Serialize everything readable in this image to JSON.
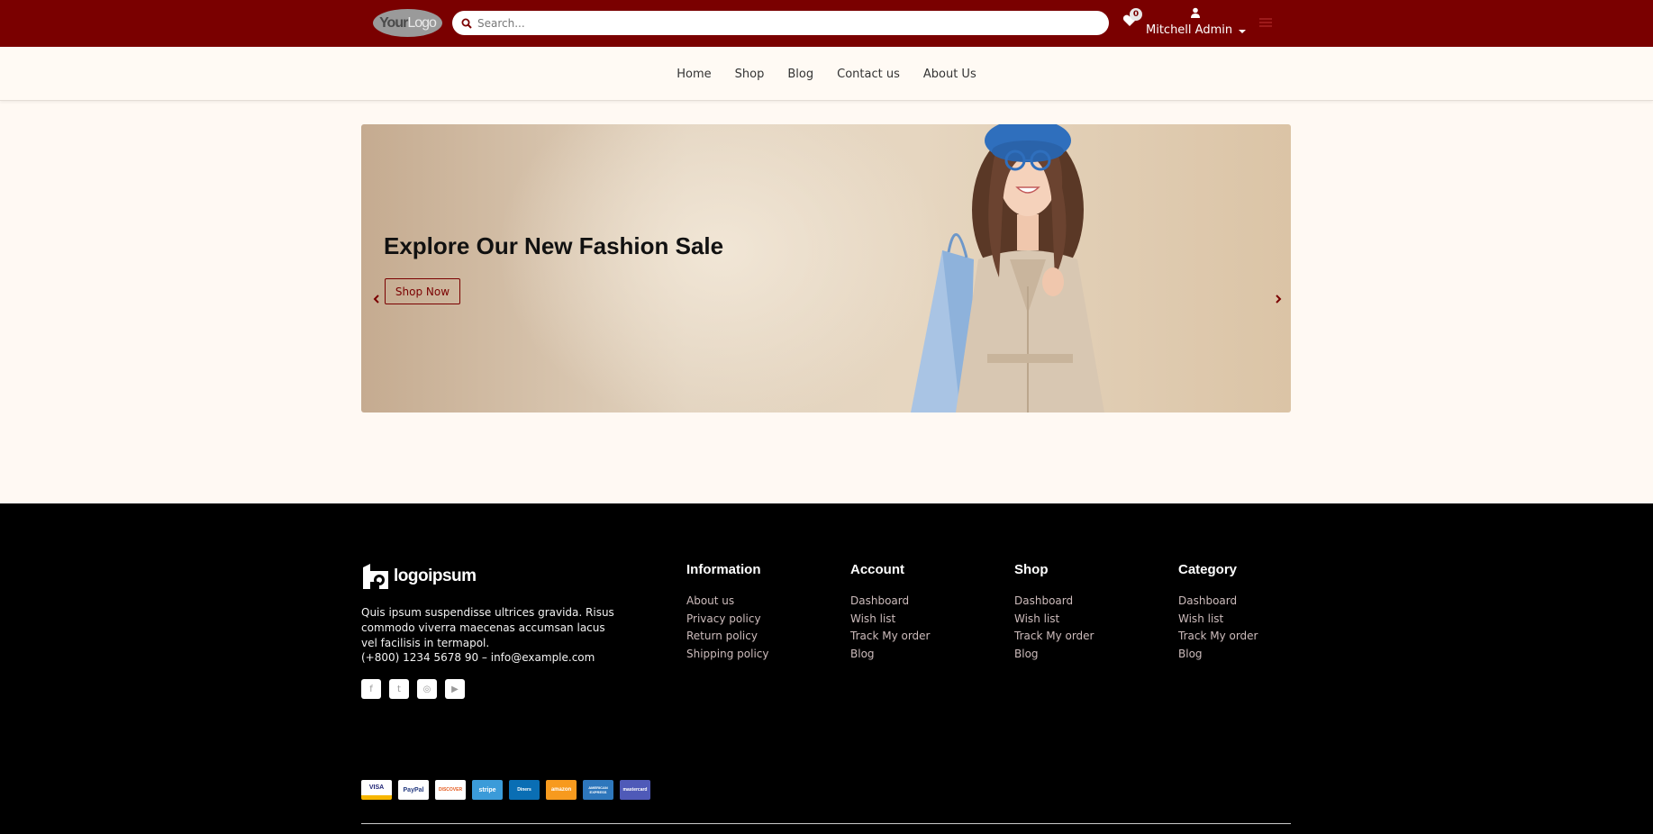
{
  "header": {
    "logo": {
      "bold": "Your",
      "light": "Logo"
    },
    "search_placeholder": "Search...",
    "wishlist_count": "0",
    "user_name": "Mitchell Admin"
  },
  "nav": {
    "items": [
      {
        "label": "Home"
      },
      {
        "label": "Shop"
      },
      {
        "label": "Blog"
      },
      {
        "label": "Contact us"
      },
      {
        "label": "About Us"
      }
    ]
  },
  "hero": {
    "title": "Explore Our New Fashion Sale",
    "button": "Shop Now"
  },
  "footer": {
    "logo_text": "logoipsum",
    "description": "Quis ipsum suspendisse ultrices gravida. Risus commodo viverra maecenas accumsan lacus vel facilisis in termapol.",
    "contact": "(+800) 1234 5678 90 – info@example.com",
    "social": [
      "facebook-icon",
      "twitter-icon",
      "instagram-icon",
      "youtube-icon"
    ],
    "columns": [
      {
        "title": "Information",
        "links": [
          "About us",
          "Privacy policy",
          "Return policy",
          "Shipping policy"
        ]
      },
      {
        "title": "Account",
        "links": [
          "Dashboard",
          "Wish list",
          "Track My order",
          "Blog"
        ]
      },
      {
        "title": "Shop",
        "links": [
          "Dashboard",
          "Wish list",
          "Track My order",
          "Blog"
        ]
      },
      {
        "title": "Category",
        "links": [
          "Dashboard",
          "Wish list",
          "Track My order",
          "Blog"
        ]
      }
    ],
    "payments": [
      {
        "name": "VISA",
        "color": "#1a1f71"
      },
      {
        "name": "PayPal",
        "color": "#ffffff"
      },
      {
        "name": "DISCOVER",
        "color": "#ffffff"
      },
      {
        "name": "stripe",
        "color": "#3b9bd9"
      },
      {
        "name": "Diners",
        "color": "#0a6eb4"
      },
      {
        "name": "amazon",
        "color": "#f79a1e"
      },
      {
        "name": "AMERICAN EXPRESS",
        "color": "#2e77bc"
      },
      {
        "name": "mastercard",
        "color": "#4f5ab8"
      }
    ]
  },
  "colors": {
    "brand": "#7a0000",
    "background": "#fff9f3",
    "footer": "#000000"
  }
}
